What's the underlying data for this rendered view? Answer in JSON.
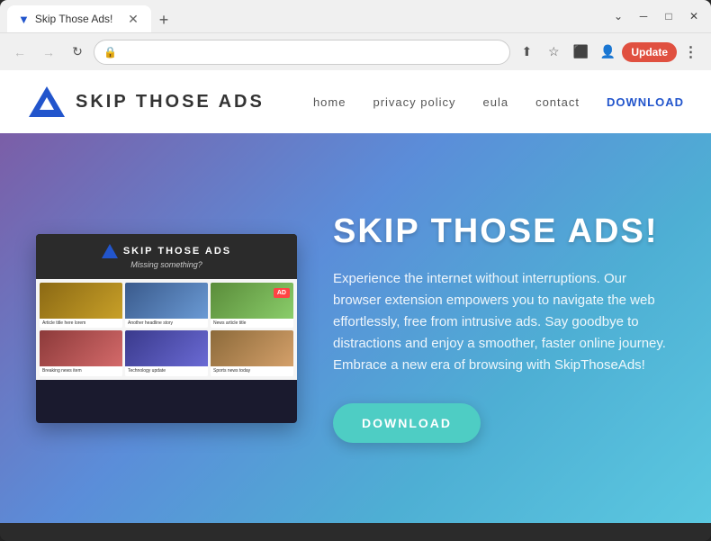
{
  "browser": {
    "tab": {
      "favicon_symbol": "▼",
      "title": "Skip Those Ads!",
      "close_symbol": "✕"
    },
    "new_tab_symbol": "+",
    "controls": {
      "minimize": "─",
      "maximize": "□",
      "close": "✕",
      "chevron_down": "⌄"
    },
    "nav": {
      "back_symbol": "←",
      "forward_symbol": "→",
      "reload_symbol": "↻"
    },
    "address": "",
    "address_placeholder": "",
    "lock_symbol": "🔒",
    "toolbar_icons": {
      "share": "⬆",
      "star": "☆",
      "extensions": "⬛",
      "profile": "👤"
    },
    "update_label": "Update",
    "three_dots": "⋮"
  },
  "site": {
    "logo_text": "SKIP  THOSE  ADS",
    "nav": {
      "home": "Home",
      "privacy_policy": "Privacy Policy",
      "eula": "EULA",
      "contact": "Contact",
      "download": "DOWNLOAD"
    },
    "hero": {
      "screenshot": {
        "title": "SKIP  THOSE  ADS",
        "subtitle": "Missing something?",
        "ad_badge": "AD"
      },
      "title": "SKIP THOSe ADS!",
      "description": "Experience the internet without interruptions. Our browser extension empowers you to navigate the web effortlessly, free from intrusive ads. Say goodbye to distractions and enjoy a smoother, faster online journey. Embrace a new era of browsing with SkipThoseAds!",
      "cta_button": "DOWNLOAD"
    }
  }
}
